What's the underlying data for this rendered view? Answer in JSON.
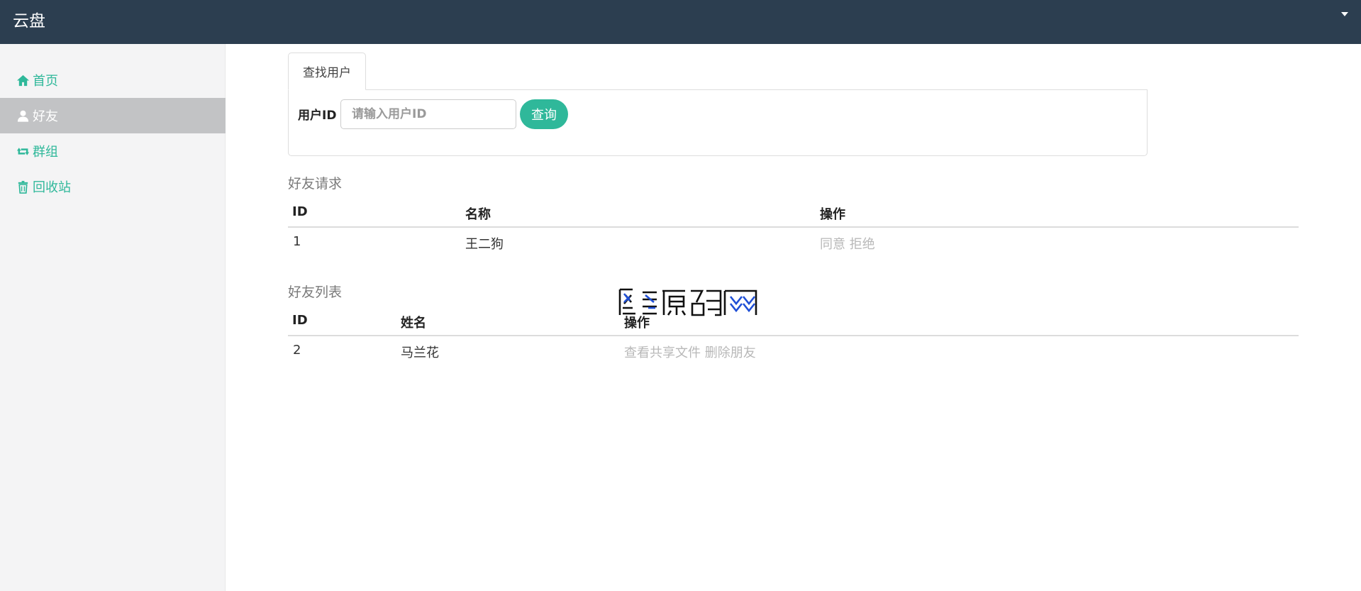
{
  "app": {
    "title": "云盘"
  },
  "sidebar": {
    "items": [
      {
        "label": "首页",
        "icon": "home-icon"
      },
      {
        "label": "好友",
        "icon": "user-icon",
        "active": true
      },
      {
        "label": "群组",
        "icon": "retweet-icon"
      },
      {
        "label": "回收站",
        "icon": "trash-icon"
      }
    ]
  },
  "search": {
    "tab_label": "查找用户",
    "field_label": "用户ID",
    "placeholder": "请输入用户ID",
    "button_label": "查询"
  },
  "friend_requests": {
    "title": "好友请求",
    "columns": [
      "ID",
      "名称",
      "操作"
    ],
    "rows": [
      {
        "id": "1",
        "name": "王二狗",
        "actions": [
          "同意",
          "拒绝"
        ]
      }
    ]
  },
  "friend_list": {
    "title": "好友列表",
    "columns": [
      "ID",
      "姓名",
      "操作"
    ],
    "rows": [
      {
        "id": "2",
        "name": "马兰花",
        "actions": [
          "查看共享文件",
          "删除朋友"
        ]
      }
    ]
  },
  "colors": {
    "navbar": "#2c3e50",
    "accent": "#2fb89a",
    "sidebar_active": "#c2c3c5",
    "muted_link": "#b8b8b8"
  }
}
